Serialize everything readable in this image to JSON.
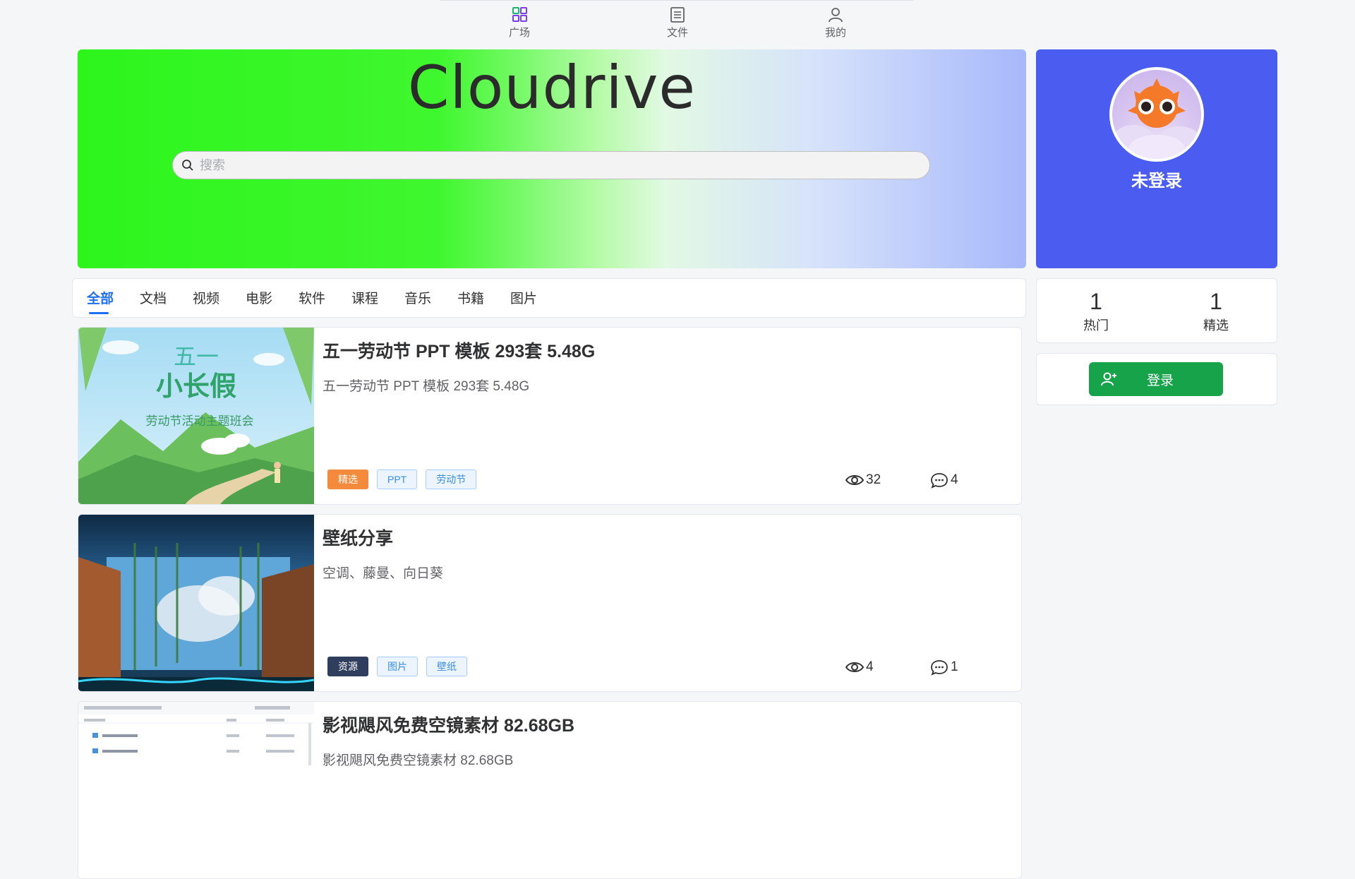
{
  "nav": {
    "items": [
      {
        "label": "广场",
        "icon": "grid-icon"
      },
      {
        "label": "文件",
        "icon": "document-list-icon"
      },
      {
        "label": "我的",
        "icon": "user-icon"
      }
    ]
  },
  "hero": {
    "title": "Cloudrive",
    "search_placeholder": "搜索"
  },
  "profile": {
    "name": "未登录"
  },
  "tabs": [
    "全部",
    "文档",
    "视频",
    "电影",
    "软件",
    "课程",
    "音乐",
    "书籍",
    "图片"
  ],
  "stats": [
    {
      "value": "1",
      "label": "热门"
    },
    {
      "value": "1",
      "label": "精选"
    }
  ],
  "login": {
    "label": "登录"
  },
  "posts": [
    {
      "title": "五一劳动节 PPT 模板 293套 5.48G",
      "desc": "五一劳动节 PPT 模板 293套 5.48G",
      "tags": [
        "精选",
        "PPT",
        "劳动节"
      ],
      "views": "32",
      "comments": "4",
      "thumb_text": {
        "line1": "五一",
        "line2": "小长假",
        "line3": "劳动节活动主题班会"
      }
    },
    {
      "title": "壁纸分享",
      "desc": "空调、藤曼、向日葵",
      "tags": [
        "资源",
        "图片",
        "壁纸"
      ],
      "views": "4",
      "comments": "1"
    },
    {
      "title": "影视飓风免费空镜素材 82.68GB",
      "desc": "影视飓风免费空镜素材 82.68GB"
    }
  ],
  "colors": {
    "primary": "#1e6ff5",
    "profile_bg": "#4b5cf0",
    "login_green": "#17a34a",
    "tag_orange": "#f38a3c",
    "tag_dark": "#2e3e5c"
  }
}
